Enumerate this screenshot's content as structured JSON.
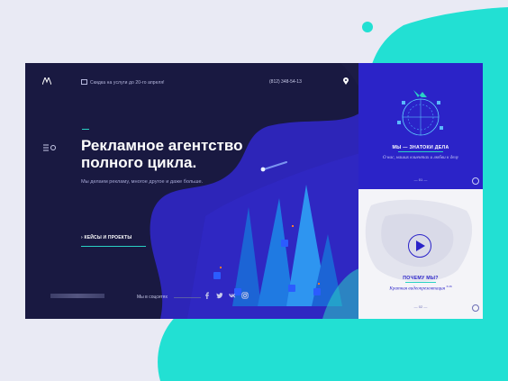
{
  "colors": {
    "accent": "#2ad1c3",
    "card": "#1c1c45",
    "panel": "#2b23c8",
    "page_bg": "#e9eaf4",
    "blob": "#22e0d3"
  },
  "header": {
    "logo_icon": "mountain-logo-icon",
    "promo_text": "Скидка на услуги до 20-го апреля!",
    "phone": "(812) 348-54-13",
    "location_icon": "map-pin-icon"
  },
  "hero": {
    "menu_icon": "menu-icon",
    "title_line1": "Рекламное агентство",
    "title_line2": "полного цикла.",
    "subtitle": "Мы делаем рекламу, многое другое и даже больше.",
    "cta": "› КЕЙСЫ И ПРОЕКТЫ"
  },
  "footer": {
    "social_label": "Мы в соцсетях",
    "socials": [
      "facebook-icon",
      "twitter-icon",
      "vk-icon",
      "instagram-icon"
    ]
  },
  "right_top": {
    "title": "МЫ — ЗНАТОКИ ДЕЛА",
    "subtitle": "О нас, наших клиентах и любви к делу",
    "pager": "— 01 —"
  },
  "right_bottom": {
    "title": "ПОЧЕМУ МЫ?",
    "subtitle": "Краткая видеопрезентация",
    "duration": "3:26",
    "pager": "— 02 —"
  }
}
